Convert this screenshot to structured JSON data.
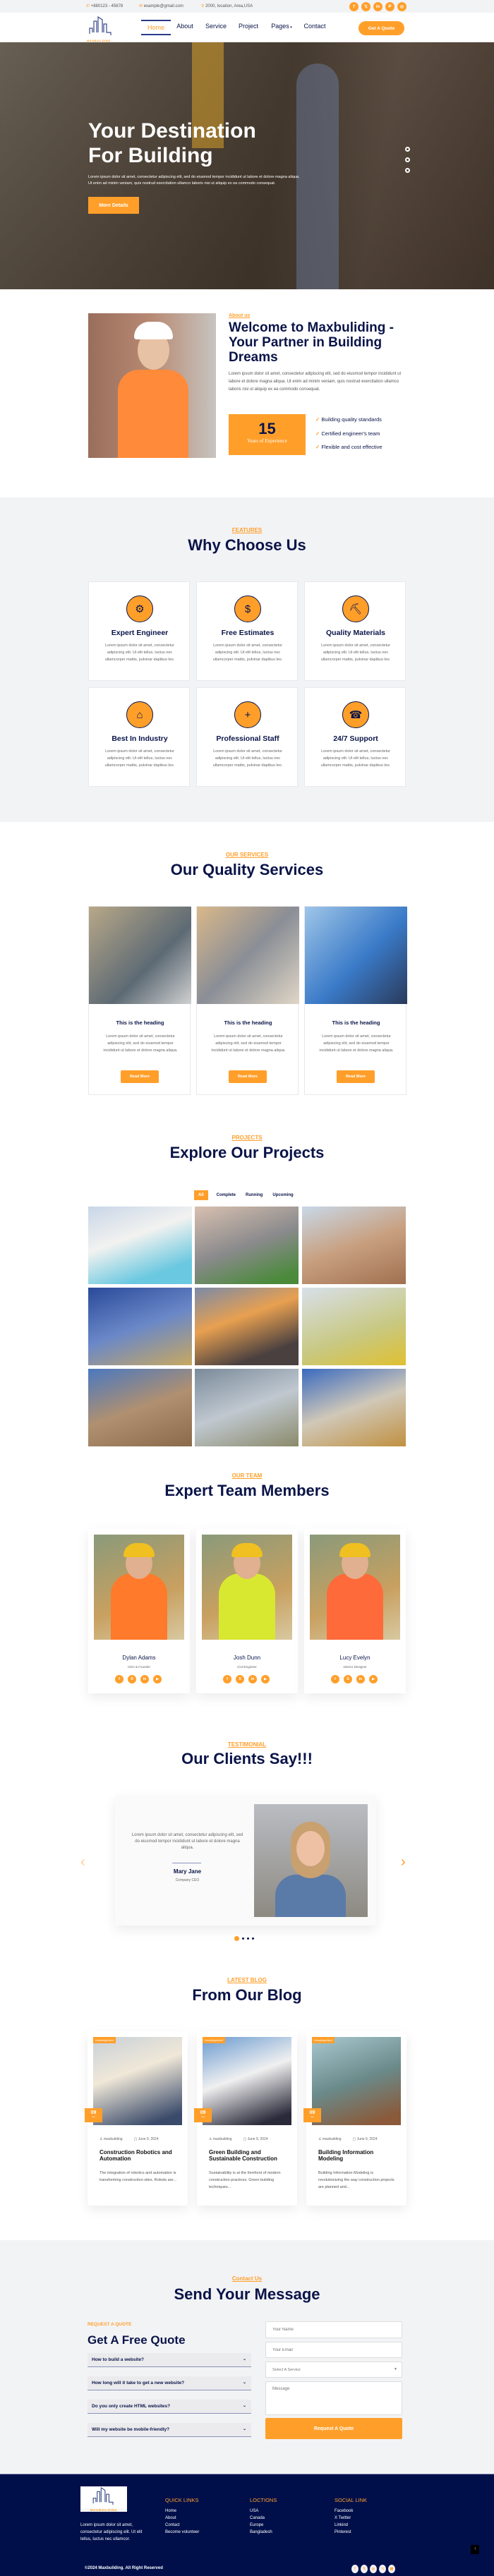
{
  "colors": {
    "accent": "#ff9f2a",
    "navy": "#0a1448",
    "light_bg": "#f2f3f5",
    "footer_bg": "#000f4a"
  },
  "topbar": {
    "phone": "+880123 - 45678",
    "email": "example@gmail.com",
    "location": "2000, location, Area,USA",
    "social": [
      "facebook-icon",
      "x-icon",
      "linkedin-icon",
      "pinterest-icon",
      "instagram-icon"
    ]
  },
  "nav": {
    "logo_text": "MAXBUILDING",
    "items": [
      "Home",
      "About",
      "Service",
      "Project",
      "Pages",
      "Contact"
    ],
    "active": "Home",
    "cta": "Get A Quote"
  },
  "hero": {
    "title_line1": "Your Destination",
    "title_line2": "For Building",
    "text_line1": "Lorem ipsum dolor sit amet, consectetur adipiscing elit, sed do eiusmod tempor incididunt ut labore et dolore magna aliqua.",
    "text_line2": "Ut enim ad minim veniam, quis nostrud exercitation ullamco laboris nisi ut aliquip ex ea commodo consequat.",
    "button": "More Details"
  },
  "about": {
    "label": "About us",
    "title": "Welcome to Maxbuliding - Your Partner in Building Dreams",
    "text": "Lorem ipsum dolor sit amet, consectetur adipiscing elit, sed do eiusmod tempor incididunt ut labore et dolore magna aliqua. Ut enim ad minim veniam, quis nostrud exercitation ullamco laboris nisi ut aliquip ex ea commodo consequat.",
    "years": "15",
    "years_label": "Years of Experience",
    "checks": [
      "Building quality standards",
      "Certified engineer's team",
      "Flexible and cost effective"
    ]
  },
  "features": {
    "label": "FEATURES",
    "title": "Why Choose Us",
    "items": [
      {
        "title": "Expert Engineer",
        "icon": "engineer-team-icon",
        "text": "Lorem ipsum dolor sit amet, consectetur adipiscing elit. Ut elit tellus, luctus nec ullamcorper mattis, pulvinar dapibus leo."
      },
      {
        "title": "Free Estimates",
        "icon": "invoice-dollar-icon",
        "text": "Lorem ipsum dolor sit amet, consectetur adipiscing elit. Ut elit tellus, luctus nec ullamcorper mattis, pulvinar dapibus leo."
      },
      {
        "title": "Quality Materials",
        "icon": "excavator-icon",
        "text": "Lorem ipsum dolor sit amet, consectetur adipiscing elit. Ut elit tellus, luctus nec ullamcorper mattis, pulvinar dapibus leo."
      },
      {
        "title": "Best In Industry",
        "icon": "house-icon",
        "text": "Lorem ipsum dolor sit amet, consectetur adipiscing elit. Ut elit tellus, luctus nec ullamcorper mattis, pulvinar dapibus leo."
      },
      {
        "title": "Professional Staff",
        "icon": "user-plus-icon",
        "text": "Lorem ipsum dolor sit amet, consectetur adipiscing elit. Ut elit tellus, luctus nec ullamcorper mattis, pulvinar dapibus leo."
      },
      {
        "title": "24/7 Support",
        "icon": "support-agent-icon",
        "text": "Lorem ipsum dolor sit amet, consectetur adipiscing elit. Ut elit tellus, luctus nec ullamcorper mattis, pulvinar dapibus leo."
      }
    ]
  },
  "services": {
    "label": "OUR SERVICES",
    "title": "Our Quality Services",
    "items": [
      {
        "heading": "This is the heading",
        "text": "Lorem ipsum dolor sit amet, consectetur adipiscing elit, sed do eiusmod tempor incididunt ut labore et dolore magna aliqua.",
        "button": "Read More"
      },
      {
        "heading": "This is the heading",
        "text": "Lorem ipsum dolor sit amet, consectetur adipiscing elit, sed do eiusmod tempor incididunt ut labore et dolore magna aliqua.",
        "button": "Read More"
      },
      {
        "heading": "This is the heading",
        "text": "Lorem ipsum dolor sit amet, consectetur adipiscing elit, sed do eiusmod tempor incididunt ut labore et dolore magna aliqua.",
        "button": "Read More"
      }
    ]
  },
  "projects": {
    "label": "PROJECTS",
    "title": "Explore Our Projects",
    "filters": [
      "All",
      "Complete",
      "Running",
      "Upcoming"
    ],
    "active_filter": "All"
  },
  "team": {
    "label": "OUR TEAM",
    "title": "Expert Team Members",
    "members": [
      {
        "name": "Dylan Adams",
        "role": "CEO & Founder"
      },
      {
        "name": "Josh Dunn",
        "role": "Civil Engineer"
      },
      {
        "name": "Lucy Evelyn",
        "role": "Interior Designer"
      }
    ],
    "social": [
      "facebook-icon",
      "skype-icon",
      "linkedin-icon",
      "youtube-icon"
    ]
  },
  "testimonial": {
    "label": "TESTIMONIAL",
    "title": "Our Clients Say!!!",
    "quote": "Lorem ipsum dolor sit amet, consectetur adipiscing elit, sed do eiusmod tempor incididunt ut labore et dolore magna aliqua.",
    "name": "Mary Jane",
    "role": "Company CEO",
    "slides": 4,
    "active_slide": 1
  },
  "blog": {
    "label": "LATEST BLOG",
    "title": "From Our Blog",
    "posts": [
      {
        "category": "Uncategorized",
        "day": "09",
        "month": "Jun",
        "author": "maxbuilding",
        "date": "June 9, 2024",
        "title": "Construction Robotics and Automation",
        "excerpt": "The integration of robotics and automation is transforming construction sites. Robots are..."
      },
      {
        "category": "Uncategorized",
        "day": "09",
        "month": "Jun",
        "author": "maxbuilding",
        "date": "June 9, 2024",
        "title": "Green Building and Sustainable Construction",
        "excerpt": "Sustainability is at the forefront of modern construction practices. Green building techniques..."
      },
      {
        "category": "Uncategorized",
        "day": "09",
        "month": "Jun",
        "author": "maxbuilding",
        "date": "June 9, 2024",
        "title": "Building Information Modeling",
        "excerpt": "Building Information Modeling is revolutionizing the way construction projects are planned and..."
      }
    ]
  },
  "contact": {
    "label": "Contact Us",
    "title": "Send Your Message",
    "sub_label": "REQUEST A QUOTE",
    "sub_title": "Get A Free Quote",
    "faq": [
      "How to build a website?",
      "How long will it take to get a new website?",
      "Do you only create HTML websites?",
      "Will my website be mobile-friendly?"
    ],
    "name_placeholder": "Your Name",
    "email_placeholder": "Your Email",
    "service_select": "Select A Service",
    "message_placeholder": "Message",
    "submit": "Request A Quote"
  },
  "footer": {
    "logo_text": "MAXBUILDING",
    "about": "Lorem ipsum dolor sit amet, consectetur adipiscing elit. Ut elit tellus, luctus nec ullamcor.",
    "columns": [
      {
        "title": "QUICK LINKS",
        "links": [
          "Home",
          "About",
          "Contact",
          "Become volunteer"
        ]
      },
      {
        "title": "LOCTIONS",
        "links": [
          "USA",
          "Canada",
          "Europe",
          "Bangladesh"
        ]
      },
      {
        "title": "SOCIAL LINK",
        "links": [
          "Facebook",
          "X Twitter",
          "Linkind",
          "Pinterest"
        ]
      }
    ],
    "copyright": "©2024 Maxbuilding. All Right Reserved",
    "social": [
      "facebook-icon",
      "x-icon",
      "instagram-icon",
      "github-icon",
      "calendar-icon"
    ]
  }
}
